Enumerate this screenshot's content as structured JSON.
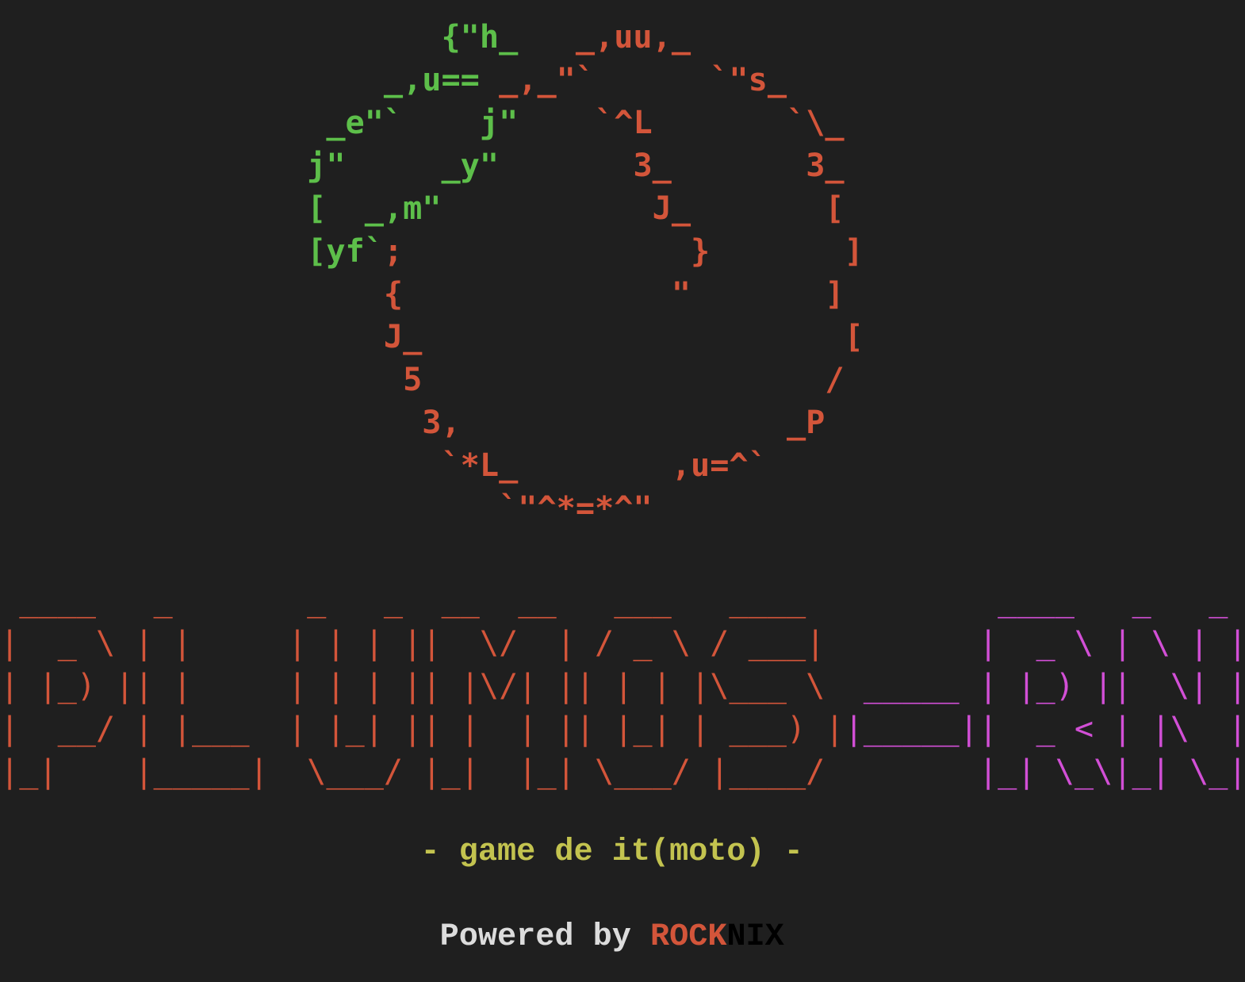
{
  "colors": {
    "background": "#1f1f1f",
    "green": "#5dbf4a",
    "orange": "#d3553a",
    "magenta": "#d24fd6",
    "yellow": "#c3c34f",
    "white": "#dcdcdc",
    "black": "#000000"
  },
  "logo_art": [
    [
      {
        "t": "                       ",
        "c": "green"
      },
      {
        "t": "{\"h_",
        "c": "green"
      },
      {
        "t": "   _,uu,_",
        "c": "orange"
      }
    ],
    [
      {
        "t": "                    ",
        "c": "green"
      },
      {
        "t": "_,u==",
        "c": "green"
      },
      {
        "t": " _,_\"`      `\"s_",
        "c": "orange"
      }
    ],
    [
      {
        "t": "                 ",
        "c": "green"
      },
      {
        "t": "_e\"`    j\"",
        "c": "green"
      },
      {
        "t": "    `^L       `\\_",
        "c": "orange"
      }
    ],
    [
      {
        "t": "                ",
        "c": "green"
      },
      {
        "t": "j\"     _y\"",
        "c": "green"
      },
      {
        "t": "       3_       3_",
        "c": "orange"
      }
    ],
    [
      {
        "t": "                ",
        "c": "green"
      },
      {
        "t": "[  _,m\"",
        "c": "green"
      },
      {
        "t": "           J_       [",
        "c": "orange"
      }
    ],
    [
      {
        "t": "                ",
        "c": "green"
      },
      {
        "t": "[yf`",
        "c": "green"
      },
      {
        "t": ";               }       ]",
        "c": "orange"
      }
    ],
    [
      {
        "t": "                    {              \"       ]",
        "c": "orange"
      }
    ],
    [
      {
        "t": "                    J_                      [",
        "c": "orange"
      }
    ],
    [
      {
        "t": "                     5                     /",
        "c": "orange"
      }
    ],
    [
      {
        "t": "                      3,                 _P",
        "c": "orange"
      }
    ],
    [
      {
        "t": "                       `*L_        ,u=^`",
        "c": "orange"
      }
    ],
    [
      {
        "t": "                          `\"^*=*^\"",
        "c": "orange"
      }
    ]
  ],
  "title_art": [
    [
      {
        "t": " ____   _       _   _  __  __   ___   ____  ",
        "c": "orange"
      },
      {
        "t": "       ",
        "c": "magenta"
      },
      {
        "t": " ____   _   _ ",
        "c": "magenta"
      }
    ],
    [
      {
        "t": "|  _ \\ | |     | | | ||  \\/  | / _ \\ / ___| ",
        "c": "orange"
      },
      {
        "t": "       ",
        "c": "magenta"
      },
      {
        "t": "|  _ \\ | \\ | |",
        "c": "magenta"
      }
    ],
    [
      {
        "t": "| |_) || |     | | | || |\\/| || | | |\\___ \\ ",
        "c": "orange"
      },
      {
        "t": " _____ ",
        "c": "magenta"
      },
      {
        "t": "| |_) ||  \\| |",
        "c": "magenta"
      }
    ],
    [
      {
        "t": "|  __/ | |___  | |_| || |  | || |_| | ___) |",
        "c": "orange"
      },
      {
        "t": "|_____|",
        "c": "magenta"
      },
      {
        "t": "|  _ < | |\\  |",
        "c": "magenta"
      }
    ],
    [
      {
        "t": "|_|    |_____|  \\___/ |_|  |_| \\___/ |____/ ",
        "c": "orange"
      },
      {
        "t": "       ",
        "c": "magenta"
      },
      {
        "t": "|_| \\_\\|_| \\_|",
        "c": "magenta"
      }
    ]
  ],
  "subtitle": "                      - game de it(moto) -",
  "powered": {
    "prefix": "                       Powered by ",
    "brand_a": "ROCK",
    "brand_b": "NIX"
  }
}
